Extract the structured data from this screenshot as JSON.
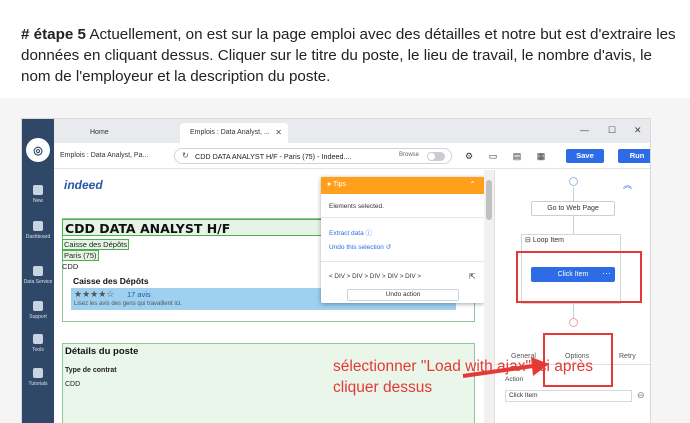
{
  "intro": {
    "step": "# étape 5",
    "text": " Actuellement, on est sur la page emploi avec des détailles et notre but est d'extraire les données en cliquant dessus. Cliquer sur le titre du poste, le lieu de travail, le nombre d'avis, le nom de l'employeur et la description du poste."
  },
  "nav": {
    "items": [
      "New",
      "Dashboard",
      "Data Service",
      "Support",
      "Tools",
      "Tutorials"
    ]
  },
  "browser": {
    "tabs": [
      "Home",
      "Emplois : Data Analyst, ..."
    ],
    "task_title": "Emplois : Data Analyst, Pa...",
    "url": "CDD DATA ANALYST H/F - Paris (75) - Indeed....",
    "browse_label": "Browse",
    "save_label": "Save",
    "run_label": "Run"
  },
  "webpage": {
    "logo": "indeed",
    "job_title": "CDD DATA ANALYST H/F",
    "employer": "Caisse des Dépôts",
    "location": "Paris (75)",
    "contract": "CDD",
    "company_card_name": "Caisse des Dépôts",
    "stars": "★★★★☆",
    "reviews": "17 avis",
    "reviews_sub": "Lisez les avis des gens qui travaillent ici.",
    "details_heading": "Détails du poste",
    "contract_type_label": "Type de contrat",
    "contract_type_value": "CDD"
  },
  "tips": {
    "title": "Tips",
    "elements_selected": "Elements selected.",
    "extract_data": "Extract data",
    "undo_selection": "Undo this selection",
    "breadcrumb": "< DIV > DIV > DIV > DIV > DIV >",
    "undo_action": "Undo action"
  },
  "workflow": {
    "go_to_web_page": "Go to Web Page",
    "loop_item": "Loop Item",
    "click_item": "Click Item",
    "tabs": [
      "General",
      "Options",
      "Retry"
    ],
    "action_label": "Action",
    "action_value": "Click Item"
  },
  "annotation": {
    "text": "sélectionner \"Load with ajax\" ici après cliquer dessus"
  },
  "colors": {
    "accent_blue": "#2d6ce6",
    "tips_orange": "#ff9f1a",
    "annotation_red": "#e53935",
    "nav_bg": "#2f4867"
  }
}
